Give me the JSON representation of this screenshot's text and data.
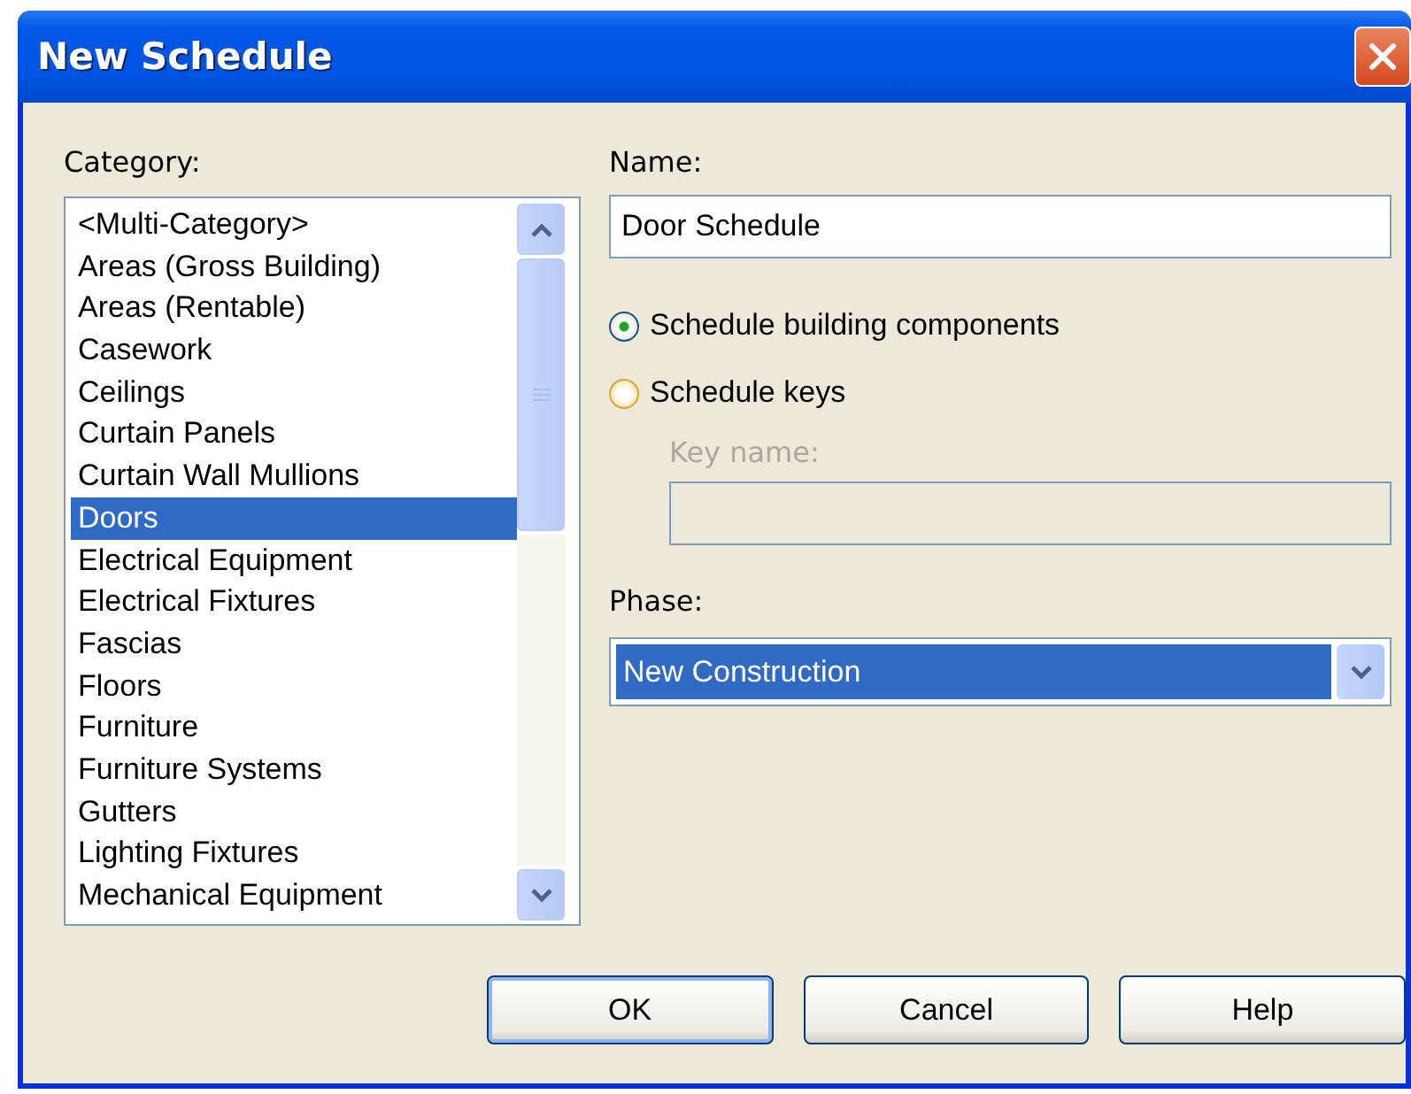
{
  "window": {
    "title": "New Schedule"
  },
  "category": {
    "label": "Category:",
    "items": [
      {
        "label": "<Multi-Category>",
        "selected": false
      },
      {
        "label": "Areas (Gross Building)",
        "selected": false
      },
      {
        "label": "Areas (Rentable)",
        "selected": false
      },
      {
        "label": "Casework",
        "selected": false
      },
      {
        "label": "Ceilings",
        "selected": false
      },
      {
        "label": "Curtain Panels",
        "selected": false
      },
      {
        "label": "Curtain Wall Mullions",
        "selected": false
      },
      {
        "label": "Doors",
        "selected": true
      },
      {
        "label": "Electrical Equipment",
        "selected": false
      },
      {
        "label": "Electrical Fixtures",
        "selected": false
      },
      {
        "label": "Fascias",
        "selected": false
      },
      {
        "label": "Floors",
        "selected": false
      },
      {
        "label": "Furniture",
        "selected": false
      },
      {
        "label": "Furniture Systems",
        "selected": false
      },
      {
        "label": "Gutters",
        "selected": false
      },
      {
        "label": "Lighting Fixtures",
        "selected": false
      },
      {
        "label": "Mechanical Equipment",
        "selected": false
      }
    ]
  },
  "name": {
    "label": "Name:",
    "value": "Door Schedule"
  },
  "options": [
    {
      "label": "Schedule building components",
      "selected": true
    },
    {
      "label": "Schedule keys",
      "selected": false
    }
  ],
  "key_name": {
    "label": "Key name:",
    "disabled": true
  },
  "phase": {
    "label": "Phase:",
    "value": "New Construction"
  },
  "buttons": [
    {
      "label": "OK",
      "default": true
    },
    {
      "label": "Cancel",
      "default": false
    },
    {
      "label": "Help",
      "default": false
    }
  ]
}
